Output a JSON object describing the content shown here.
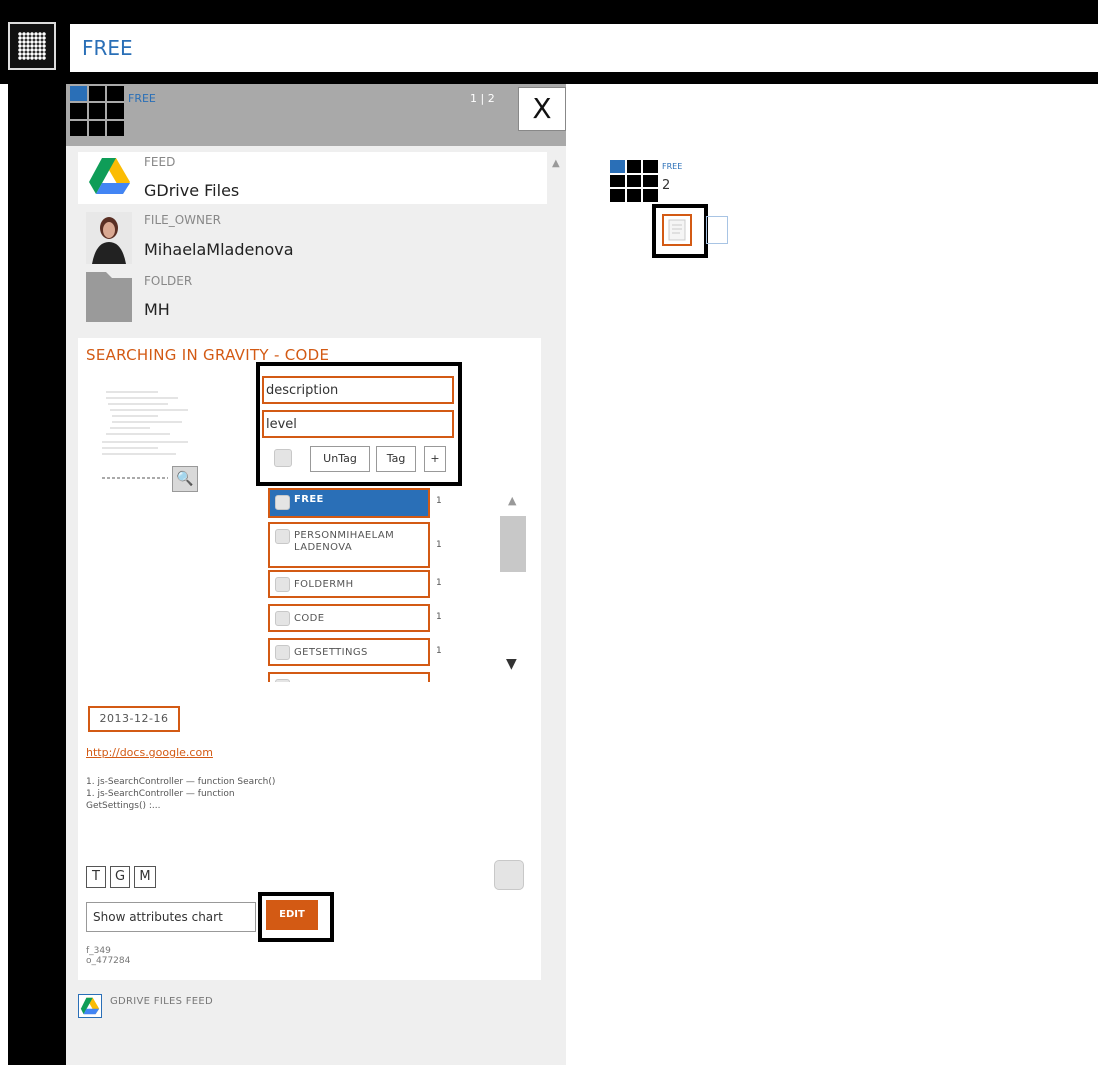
{
  "search": {
    "value": "FREE"
  },
  "panel": {
    "title": "FREE",
    "pages": "1 | 2",
    "close_label": "X"
  },
  "feed": {
    "label": "FEED",
    "value": "GDrive Files"
  },
  "owner": {
    "label": "FILE_OWNER",
    "value": "MihaelaMladenova"
  },
  "folder": {
    "label": "FOLDER",
    "value": "MH"
  },
  "doc": {
    "title": "SEARCHING IN GRAVITY - CODE",
    "description_value": "description",
    "level_value": "level",
    "untag_label": "UnTag",
    "tag_label": "Tag",
    "add_label": "+",
    "tags": [
      {
        "label": "FREE",
        "count": "1",
        "selected": true
      },
      {
        "label": "PERSONMIHAELAM LADENOVA",
        "count": "1",
        "selected": false
      },
      {
        "label": "FOLDERMH",
        "count": "1",
        "selected": false
      },
      {
        "label": "CODE",
        "count": "1",
        "selected": false
      },
      {
        "label": "GETSETTINGS",
        "count": "1",
        "selected": false
      }
    ],
    "date": "2013-12-16",
    "link": "http://docs.google.com",
    "snippet": "1. js-SearchController — function Search() 1. js-SearchController — function GetSettings() :...",
    "btn_t": "T",
    "btn_g": "G",
    "btn_m": "M",
    "chart_select": "Show attributes chart",
    "edit_label": "EDIT",
    "id_f": "f_349",
    "id_o": "o_477284"
  },
  "footer": {
    "label": "GDRIVE FILES FEED"
  },
  "node": {
    "title": "FREE",
    "count": "2"
  },
  "colors": {
    "accent": "#d35a14",
    "brand": "#2a6fb7",
    "header": "#000000"
  }
}
